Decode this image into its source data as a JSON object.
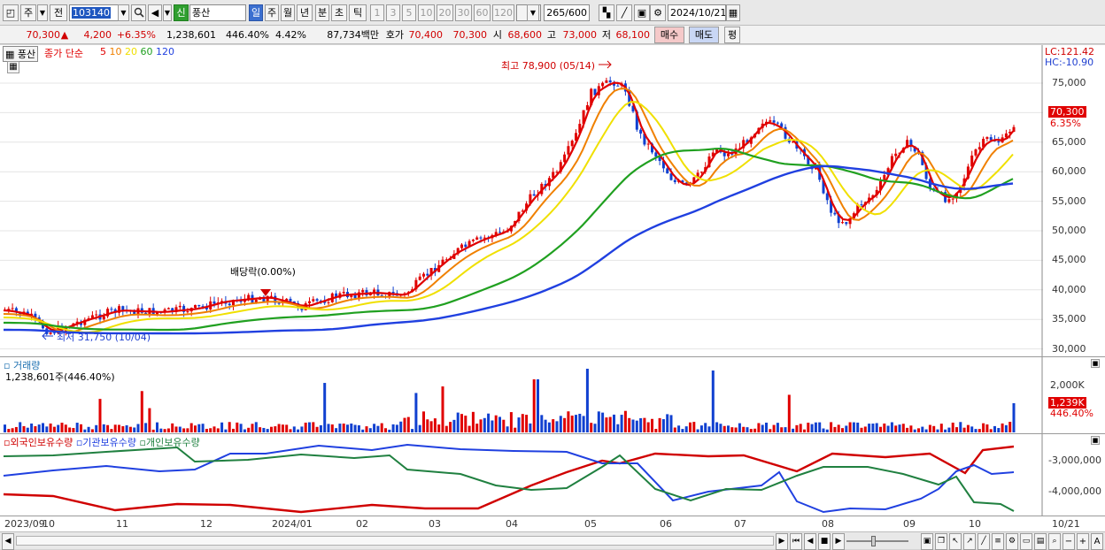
{
  "toolbar": {
    "unit_label": "주",
    "view_label": "전",
    "stock_code": "103140",
    "badge": "신",
    "stock_name": "풍산",
    "periods": [
      "일",
      "주",
      "월",
      "년",
      "분",
      "초",
      "틱"
    ],
    "selected_period": "일",
    "intervals": [
      "1",
      "3",
      "5",
      "10",
      "20",
      "30",
      "60",
      "120"
    ],
    "count": "265",
    "count_max": "/600",
    "date": "2024/10/21"
  },
  "quote": {
    "price": "70,300",
    "arrow": "▲",
    "change": "4,200",
    "change_pct": "+6.35%",
    "volume": "1,238,601",
    "vol_ratio": "446.40%",
    "turnover": "4.42%",
    "amount": "87,734백만",
    "ask_label": "호가",
    "ask1": "70,400",
    "ask2": "70,300",
    "open_label": "시",
    "open": "68,600",
    "high_label": "고",
    "high": "73,000",
    "low_label": "저",
    "low": "68,100",
    "buy": "매수",
    "sell": "매도",
    "eval": "평"
  },
  "price_panel": {
    "name_tag": "풍산",
    "legend_prefix": "종가 단순",
    "ma_legend": [
      {
        "label": "5",
        "color": "#e00000"
      },
      {
        "label": "10",
        "color": "#f08000"
      },
      {
        "label": "20",
        "color": "#f0e000"
      },
      {
        "label": "60",
        "color": "#20a020"
      },
      {
        "label": "120",
        "color": "#2040e0"
      }
    ],
    "lc": "LC:121.42",
    "hc": "HC:-10.90",
    "y_ticks": [
      "75,000",
      "70,000",
      "65,000",
      "60,000",
      "55,000",
      "50,000",
      "45,000",
      "40,000",
      "35,000",
      "30,000"
    ],
    "last_price": "70,300",
    "last_pct": "6.35%",
    "high_note": "최고 78,900 (05/14)",
    "low_note": "최저 31,750 (10/04)",
    "div_note": "배당락(0.00%)"
  },
  "volume_panel": {
    "title": "거래량",
    "value": "1,238,601주(446.40%)",
    "y_tick": "2,000K",
    "last": "1,239K",
    "last_pct": "446.40%"
  },
  "holdings_panel": {
    "series": [
      {
        "label": "외국인보유수량",
        "color": "#d00000"
      },
      {
        "label": "기관보유수량",
        "color": "#2040e0"
      },
      {
        "label": "개인보유수량",
        "color": "#208040"
      }
    ],
    "y_ticks": [
      "-3,000,000",
      "-4,000,000"
    ]
  },
  "x_axis": {
    "labels": [
      "2023/09",
      "10",
      "11",
      "12",
      "2024/01",
      "02",
      "03",
      "04",
      "05",
      "06",
      "07",
      "08",
      "09",
      "10"
    ],
    "end_label": "10/21"
  },
  "colors": {
    "up": "#e00000",
    "down": "#1040d0",
    "selected": "#3b6fd0"
  }
}
